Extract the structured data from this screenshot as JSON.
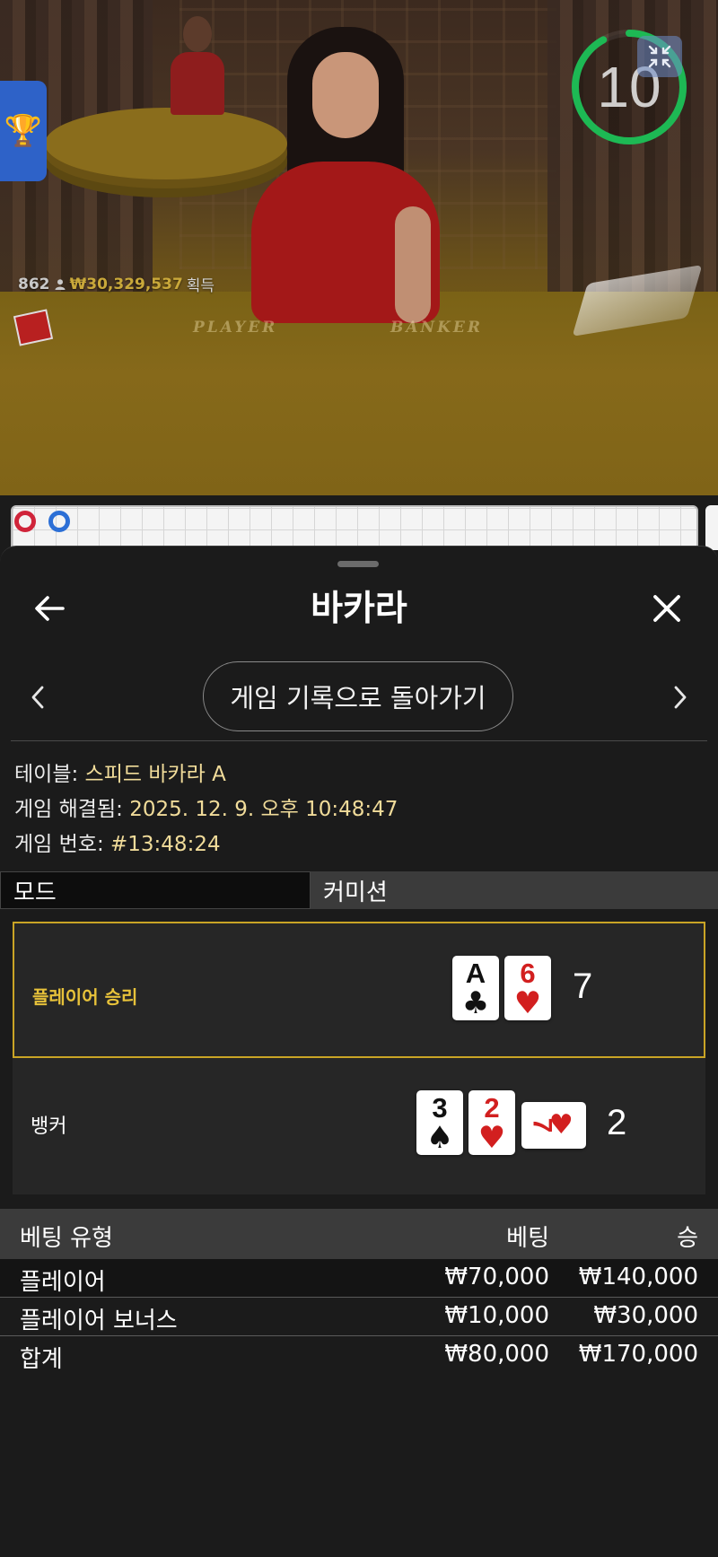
{
  "video": {
    "timer": "10",
    "winners_count": "862",
    "winners_amount": "₩30,329,537",
    "winners_suffix": "획득",
    "felt_player": "PLAYER",
    "felt_banker": "BANKER"
  },
  "sheet": {
    "title": "바카라",
    "history_button": "게임 기록으로 돌아가기"
  },
  "info": {
    "table_label": "테이블:",
    "table_value": "스피드 바카라 A",
    "resolved_label": "게임 해결됨:",
    "resolved_value": "2025. 12. 9. 오후 10:48:47",
    "number_label": "게임 번호:",
    "number_value": "#13:48:24"
  },
  "mode": {
    "label": "모드",
    "value": "커미션"
  },
  "hands": {
    "player": {
      "label": "플레이어 승리",
      "cards": [
        {
          "rank": "A",
          "suit": "♣",
          "color": "#111111"
        },
        {
          "rank": "6",
          "suit": "♥",
          "color": "#d21f1f"
        }
      ],
      "score": "7"
    },
    "banker": {
      "label": "뱅커",
      "cards": [
        {
          "rank": "3",
          "suit": "♠",
          "color": "#111111"
        },
        {
          "rank": "2",
          "suit": "♥",
          "color": "#d21f1f"
        },
        {
          "rank": "7",
          "suit": "♥",
          "color": "#d21f1f"
        }
      ],
      "score": "2"
    }
  },
  "bets": {
    "headers": {
      "type": "베팅 유형",
      "bet": "베팅",
      "win": "승"
    },
    "rows": [
      {
        "type": "플레이어",
        "bet": "₩70,000",
        "win": "₩140,000"
      },
      {
        "type": "플레이어 보너스",
        "bet": "₩10,000",
        "win": "₩30,000"
      }
    ],
    "total": {
      "type": "합계",
      "bet": "₩80,000",
      "win": "₩170,000"
    }
  },
  "colors": {
    "accent_gold": "#c9a425",
    "timer_ring": "#1db954",
    "card_red": "#d21f1f"
  },
  "icons": {
    "trophy": "trophy-icon",
    "collapse": "collapse-icon",
    "back": "back-arrow-icon",
    "close": "close-icon",
    "prev": "chevron-left-icon",
    "next": "chevron-right-icon"
  }
}
